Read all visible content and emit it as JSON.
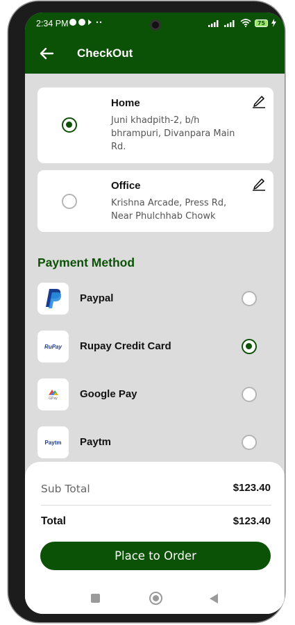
{
  "status_bar": {
    "time": "2:34 PM",
    "battery": "75"
  },
  "header": {
    "title": "CheckOut"
  },
  "addresses": [
    {
      "title": "Home",
      "address": "Juni khadpith-2, b/h bhrampuri, Divanpara Main Rd.",
      "selected": true
    },
    {
      "title": "Office",
      "address": "Krishna Arcade, Press Rd, Near Phulchhab Chowk",
      "selected": false
    }
  ],
  "payment": {
    "section_title": "Payment Method",
    "methods": [
      {
        "label": "Paypal",
        "icon": "paypal-logo",
        "selected": false
      },
      {
        "label": "Rupay Credit Card",
        "icon": "rupay-logo",
        "logo_text": "RuPay",
        "selected": true
      },
      {
        "label": "Google Pay",
        "icon": "google-pay-logo",
        "logo_text": "GPay",
        "selected": false
      },
      {
        "label": "Paytm",
        "icon": "paytm-logo",
        "logo_text": "Paytm",
        "selected": false
      }
    ]
  },
  "summary": {
    "subtotal_label": "Sub Total",
    "subtotal_value": "$123.40",
    "total_label": "Total",
    "total_value": "$123.40",
    "button_label": "Place to Order"
  },
  "colors": {
    "primary": "#0b5206",
    "background": "#dcdcdc"
  }
}
